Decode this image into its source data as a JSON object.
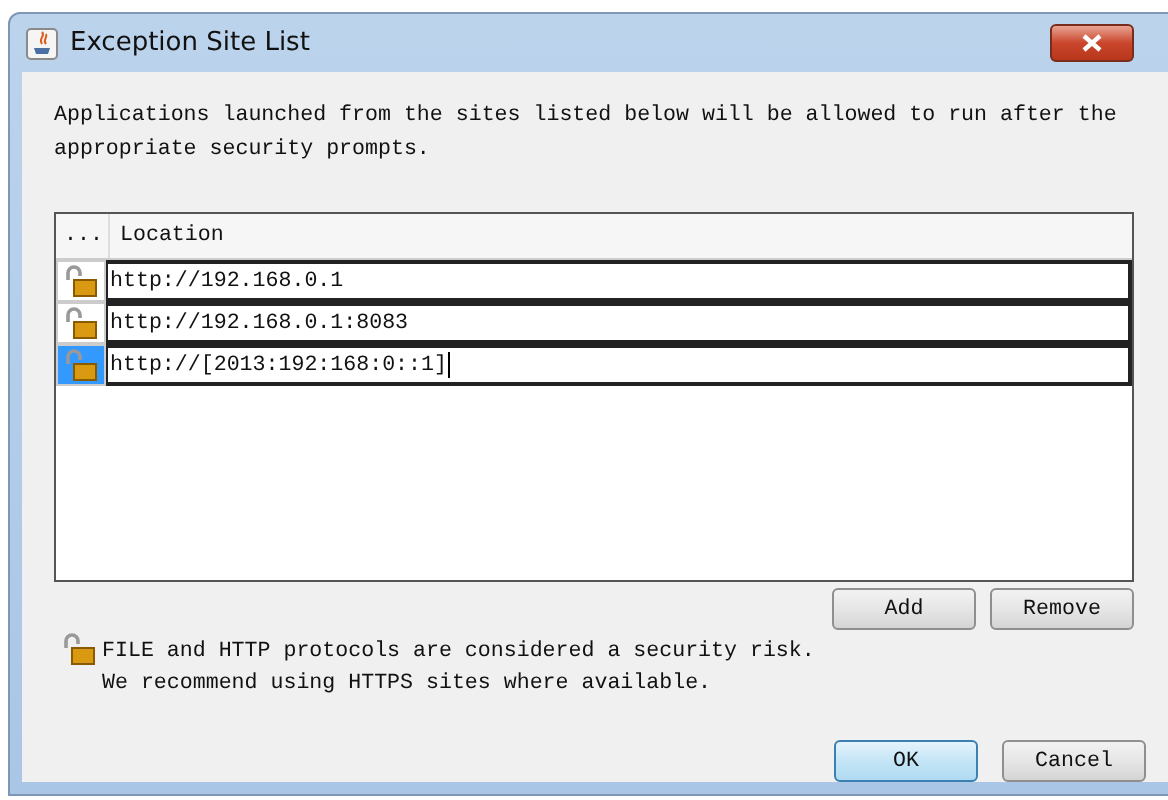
{
  "window": {
    "title": "Exception Site List"
  },
  "intro": "Applications launched from the sites listed below will be allowed to run after the appropriate security prompts.",
  "table": {
    "columns": [
      "...",
      "Location"
    ],
    "rows": [
      {
        "location": "http://192.168.0.1",
        "selected": false,
        "editing": false
      },
      {
        "location": "http://192.168.0.1:8083",
        "selected": false,
        "editing": false
      },
      {
        "location": "http://[2013:192:168:0::1]",
        "selected": true,
        "editing": true
      }
    ]
  },
  "list_buttons": [
    "Add",
    "Remove"
  ],
  "warning": [
    "FILE and HTTP protocols are considered a security risk.",
    "We recommend using HTTPS sites where available."
  ],
  "dialog_buttons": [
    {
      "label": "OK",
      "default": true
    },
    {
      "label": "Cancel",
      "default": false
    }
  ]
}
